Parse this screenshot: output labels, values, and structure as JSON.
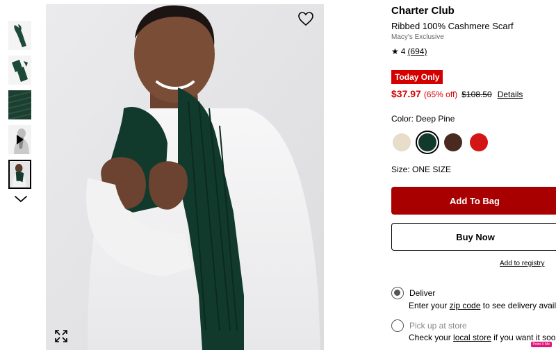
{
  "product": {
    "brand": "Charter Club",
    "name": "Ribbed 100% Cashmere Scarf",
    "exclusive": "Macy's Exclusive",
    "rating": "4",
    "review_count": "(694)"
  },
  "pricing": {
    "badge": "Today Only",
    "sale_price": "$37.97",
    "discount": "(65% off)",
    "original_price": "$108.50",
    "details_label": "Details"
  },
  "color": {
    "label": "Color: Deep Pine",
    "swatches": [
      {
        "name": "Cream",
        "color": "#e8dccb"
      },
      {
        "name": "Deep Pine",
        "color": "#123a2c"
      },
      {
        "name": "Brown",
        "color": "#4a2a20"
      },
      {
        "name": "Red",
        "color": "#d41515"
      }
    ]
  },
  "size": {
    "label": "Size: ONE SIZE"
  },
  "actions": {
    "add_to_bag": "Add To Bag",
    "buy_now": "Buy Now",
    "registry": "Add to registry"
  },
  "fulfillment": {
    "deliver_label": "Deliver",
    "deliver_prefix": "Enter your",
    "deliver_link": "zip code",
    "deliver_suffix": "to see delivery availabili",
    "pickup_label": "Pick up at store",
    "pickup_prefix": "Check your",
    "pickup_link": "local store",
    "pickup_suffix": "if you want it sooner."
  },
  "mini_badge": "Point X Me",
  "colors": {
    "accent_red": "#d40000",
    "bag_button": "#a80000",
    "scarf_green": "#123a2c"
  }
}
